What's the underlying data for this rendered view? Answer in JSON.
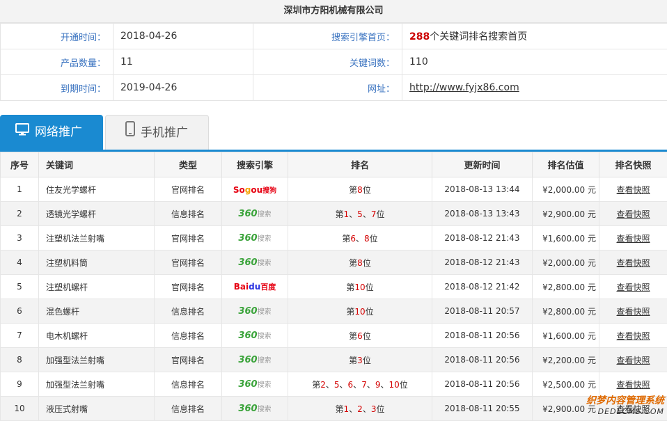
{
  "company": "深圳市方阳机械有限公司",
  "info": {
    "open_label": "开通时间：",
    "open_value": "2018-04-26",
    "search_label": "搜索引擎首页：",
    "search_count": "288",
    "search_suffix": "个关键词排名搜索首页",
    "product_label": "产品数量：",
    "product_value": "11",
    "keyword_count_label": "关键词数：",
    "keyword_count_value": "110",
    "expire_label": "到期时间：",
    "expire_value": "2019-04-26",
    "url_label": "网址：",
    "url_value": "http://www.fyjx86.com"
  },
  "tabs": {
    "web": "网络推广",
    "mobile": "手机推广"
  },
  "table": {
    "headers": [
      "序号",
      "关键词",
      "类型",
      "搜索引擎",
      "排名",
      "更新时间",
      "排名估值",
      "排名快照"
    ],
    "rows": [
      {
        "no": "1",
        "keyword": "住友光学螺杆",
        "type": "官网排名",
        "engine": "sogou",
        "rank": "第8位",
        "time": "2018-08-13 13:44",
        "price": "¥2,000.00 元",
        "snap": "查看快照"
      },
      {
        "no": "2",
        "keyword": "透镜光学螺杆",
        "type": "信息排名",
        "engine": "360",
        "rank": "第1、5、7位",
        "time": "2018-08-13 13:43",
        "price": "¥2,900.00 元",
        "snap": "查看快照"
      },
      {
        "no": "3",
        "keyword": "注塑机法兰射嘴",
        "type": "官网排名",
        "engine": "360",
        "rank": "第6、8位",
        "time": "2018-08-12 21:43",
        "price": "¥1,600.00 元",
        "snap": "查看快照"
      },
      {
        "no": "4",
        "keyword": "注塑机料筒",
        "type": "官网排名",
        "engine": "360",
        "rank": "第8位",
        "time": "2018-08-12 21:43",
        "price": "¥2,000.00 元",
        "snap": "查看快照"
      },
      {
        "no": "5",
        "keyword": "注塑机螺杆",
        "type": "官网排名",
        "engine": "baidu",
        "rank": "第10位",
        "time": "2018-08-12 21:42",
        "price": "¥2,800.00 元",
        "snap": "查看快照"
      },
      {
        "no": "6",
        "keyword": "混色螺杆",
        "type": "信息排名",
        "engine": "360",
        "rank": "第10位",
        "time": "2018-08-11 20:57",
        "price": "¥2,800.00 元",
        "snap": "查看快照"
      },
      {
        "no": "7",
        "keyword": "电木机螺杆",
        "type": "信息排名",
        "engine": "360",
        "rank": "第6位",
        "time": "2018-08-11 20:56",
        "price": "¥1,600.00 元",
        "snap": "查看快照"
      },
      {
        "no": "8",
        "keyword": "加强型法兰射嘴",
        "type": "官网排名",
        "engine": "360",
        "rank": "第3位",
        "time": "2018-08-11 20:56",
        "price": "¥2,200.00 元",
        "snap": "查看快照"
      },
      {
        "no": "9",
        "keyword": "加强型法兰射嘴",
        "type": "信息排名",
        "engine": "360",
        "rank": "第2、5、6、7、9、10位",
        "time": "2018-08-11 20:56",
        "price": "¥2,500.00 元",
        "snap": "查看快照"
      },
      {
        "no": "10",
        "keyword": "液压式射嘴",
        "type": "信息排名",
        "engine": "360",
        "rank": "第1、2、3位",
        "time": "2018-08-11 20:55",
        "price": "¥2,900.00 元",
        "snap": "查看快照"
      }
    ]
  },
  "engine_logos": {
    "360": {
      "num": "360",
      "text": "搜索"
    },
    "sogou": {
      "text1": "So",
      "text2": "g",
      "text3": "ou",
      "text4": "搜狗"
    },
    "baidu": {
      "text1": "Bai",
      "text2": "du",
      "text3": "百度"
    }
  },
  "watermark": {
    "line1": "织梦内容管理系统",
    "line2": "DEDECMS.COM"
  },
  "colors": {
    "accent": "#1a8ad1",
    "label": "#3a73c0",
    "highlight": "#cc0000"
  }
}
